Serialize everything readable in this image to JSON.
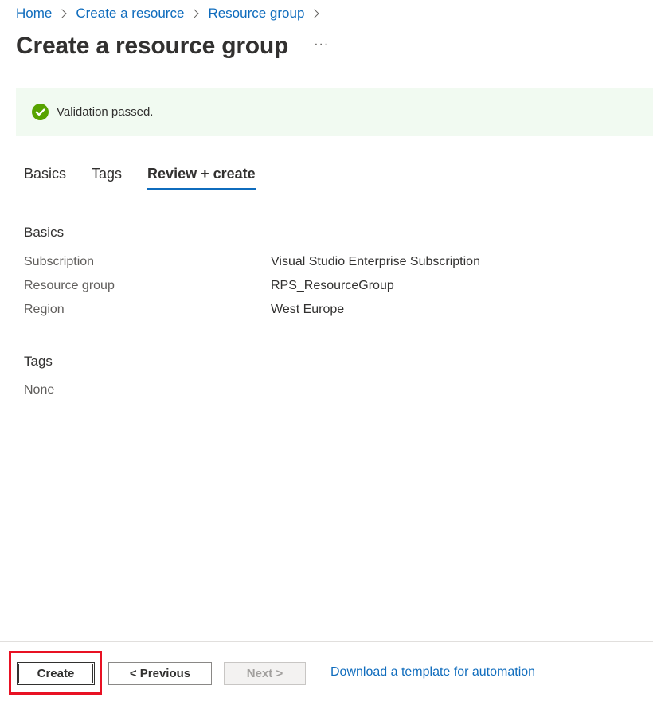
{
  "breadcrumb": {
    "items": [
      "Home",
      "Create a resource",
      "Resource group"
    ]
  },
  "header": {
    "title": "Create a resource group",
    "more_label": "···"
  },
  "banner": {
    "text": "Validation passed.",
    "status_color": "#57a300"
  },
  "tabs": [
    {
      "label": "Basics",
      "active": false
    },
    {
      "label": "Tags",
      "active": false
    },
    {
      "label": "Review + create",
      "active": true
    }
  ],
  "basics": {
    "title": "Basics",
    "rows": [
      {
        "label": "Subscription",
        "value": "Visual Studio Enterprise Subscription"
      },
      {
        "label": "Resource group",
        "value": "RPS_ResourceGroup"
      },
      {
        "label": "Region",
        "value": "West Europe"
      }
    ]
  },
  "tags": {
    "title": "Tags",
    "value": "None"
  },
  "footer": {
    "create_label": "Create",
    "previous_label": "< Previous",
    "next_label": "Next >",
    "download_label": "Download a template for automation"
  },
  "colors": {
    "accent": "#0f6cbd",
    "highlight": "#e81123"
  }
}
